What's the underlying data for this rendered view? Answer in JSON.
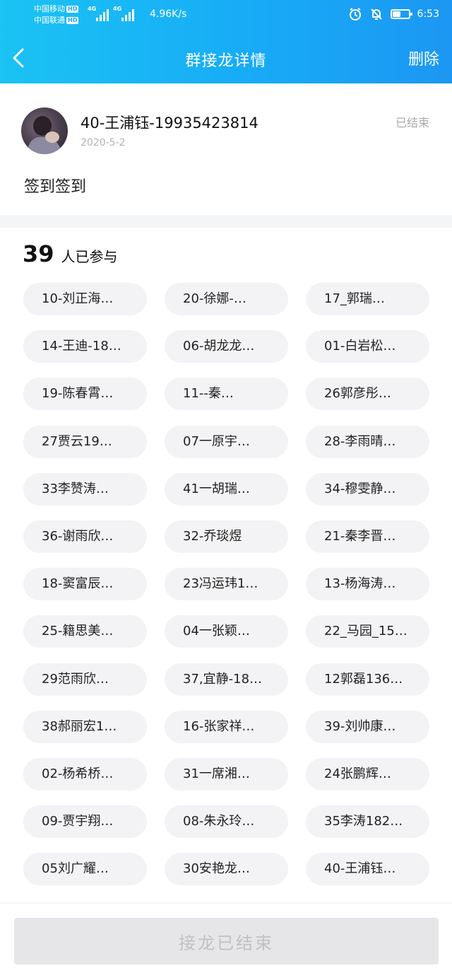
{
  "status_bar": {
    "carrier_1": "中国移动",
    "carrier_2": "中国联通",
    "hd": "HD",
    "net_1": "4G",
    "net_2": "4G",
    "speed": "4.96K/s",
    "time": "6:53",
    "battery_level": 0.55
  },
  "nav": {
    "title": "群接龙详情",
    "delete_label": "删除"
  },
  "post": {
    "author": "40-王浦钰-19935423814",
    "date": "2020-5-2",
    "state": "已结束",
    "content": "签到签到"
  },
  "participants": {
    "count": "39",
    "count_label": "人已参与",
    "names": [
      "10-刘正海…",
      "20-徐娜-…",
      "17_郭瑞…",
      "14-王迪-18…",
      "06-胡龙龙…",
      "01-白岩松…",
      "19-陈春霄…",
      "11--秦…",
      "26郭彦彤…",
      "27贾云19…",
      "07一原宇…",
      "28-李雨晴…",
      "33李赞涛…",
      "41一胡瑞…",
      "34-穆雯静…",
      "36-谢雨欣…",
      "32-乔琰煜",
      "21-秦李晋…",
      "18-窦富辰…",
      "23冯运玮1…",
      "13-杨海涛…",
      "25-籍思美…",
      "04一张颖…",
      "22_马园_15…",
      "29范雨欣…",
      "37,宜静-18…",
      "12郭磊136…",
      "38郝丽宏1…",
      "16-张家祥…",
      "39-刘帅康…",
      "02-杨希桥…",
      "31一席湘…",
      "24张鹏辉…",
      "09-贾宇翔…",
      "08-朱永玲…",
      "35李涛182…",
      "05刘广耀…",
      "30安艳龙…",
      "40-王浦钰…"
    ]
  },
  "footer": {
    "button_label": "接龙已结束"
  },
  "colors": {
    "header_start": "#1ac3f4",
    "header_end": "#1c97f3",
    "chip_bg": "#f3f3f5",
    "disabled_button_bg": "#e6e6e8",
    "disabled_button_text": "#c1c1c4"
  }
}
